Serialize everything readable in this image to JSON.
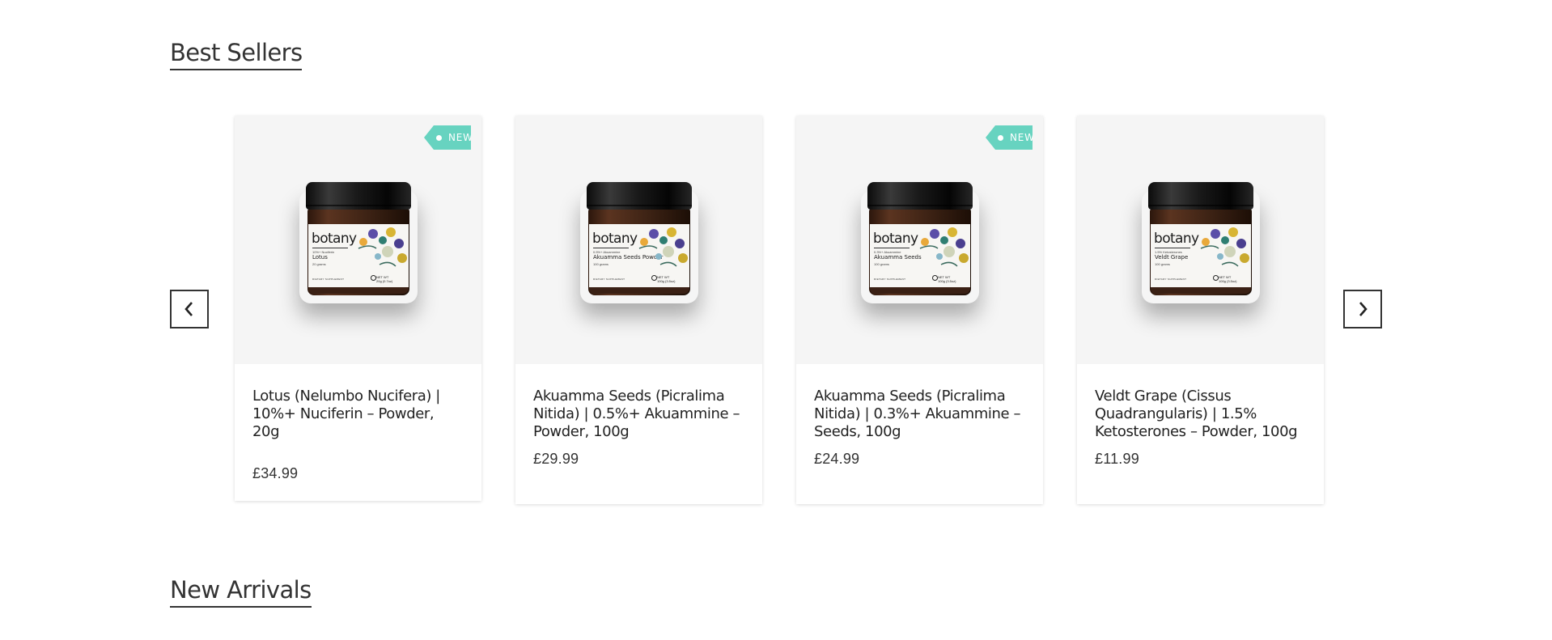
{
  "sections": {
    "best_sellers_title": "Best Sellers",
    "new_arrivals_title": "New Arrivals"
  },
  "products": [
    {
      "name": "Lotus (Nelumbo Nucifera) | 10%+ Nuciferin – Powder, 20g",
      "price": "£34.99",
      "badge": "NEW",
      "jar": {
        "brand": "botany",
        "sub": "10%+ Nuciferin",
        "product": "Lotus",
        "grams": "20 grams",
        "footer": "DIETARY SUPPLEMENT",
        "net1": "NET WT",
        "net2": "20g (0.7oz)"
      }
    },
    {
      "name": "Akuamma Seeds (Picralima Nitida) | 0.5%+ Akuammine – Powder, 100g",
      "price": "£29.99",
      "badge": "",
      "jar": {
        "brand": "botany",
        "sub": "0.5%+ Akuammine",
        "product": "Akuamma Seeds Powder",
        "grams": "100 grams",
        "footer": "DIETARY SUPPLEMENT",
        "net1": "NET WT",
        "net2": "100g (3.5oz)"
      }
    },
    {
      "name": "Akuamma Seeds (Picralima Nitida) | 0.3%+ Akuammine – Seeds, 100g",
      "price": "£24.99",
      "badge": "NEW",
      "jar": {
        "brand": "botany",
        "sub": "0.3%+ Akuammine",
        "product": "Akuamma Seeds",
        "grams": "100 grams",
        "footer": "DIETARY SUPPLEMENT",
        "net1": "NET WT",
        "net2": "100g (3.5oz)"
      }
    },
    {
      "name": "Veldt Grape (Cissus Quadrangularis) | 1.5% Ketosterones – Powder, 100g",
      "price": "£11.99",
      "badge": "",
      "jar": {
        "brand": "botany",
        "sub": "1.5% Ketosterones",
        "product": "Veldt Grape",
        "grams": "100 grams",
        "footer": "DIETARY SUPPLEMENT",
        "net1": "NET WT",
        "net2": "100g (3.5oz)"
      }
    }
  ],
  "icons": {
    "prev": "chevron-left-icon",
    "next": "chevron-right-icon"
  },
  "colors": {
    "badge": "#67d3c0",
    "card_image_bg": "#f5f5f5",
    "text": "#222222"
  }
}
